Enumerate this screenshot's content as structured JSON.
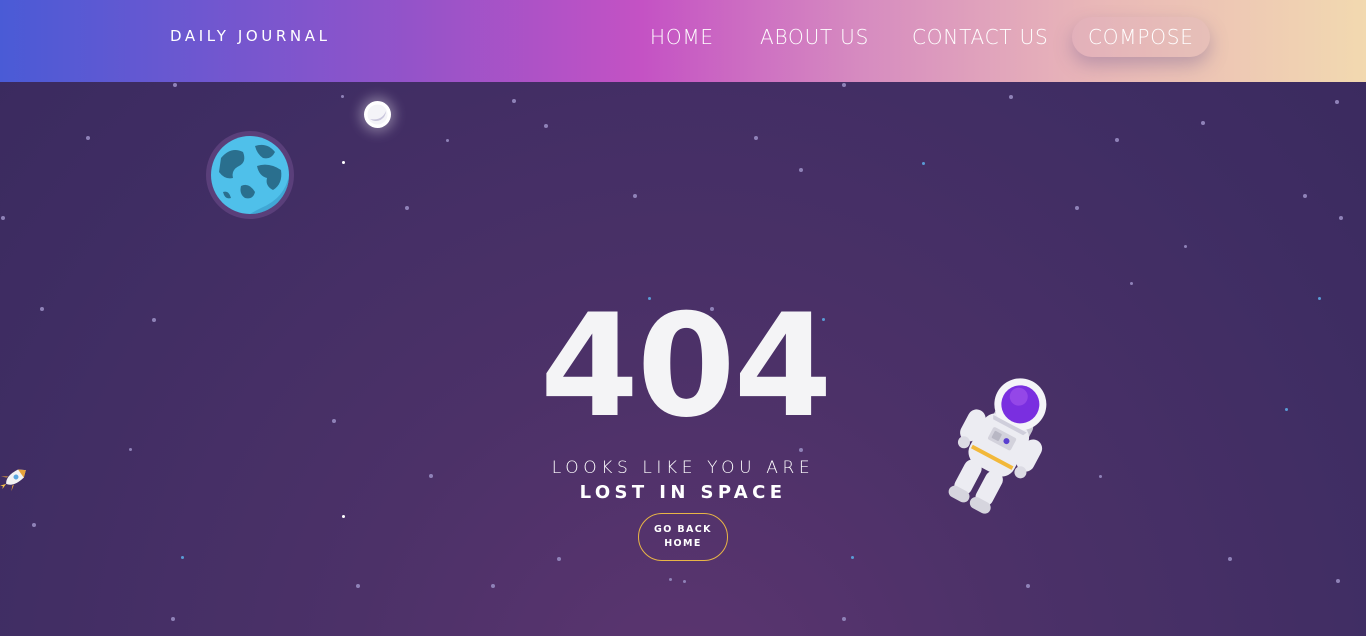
{
  "navbar": {
    "brand": "DAILY JOURNAL",
    "links": [
      {
        "label": "HOME"
      },
      {
        "label": "ABOUT US"
      },
      {
        "label": "CONTACT US"
      },
      {
        "label": "COMPOSE"
      }
    ]
  },
  "error": {
    "code": "404",
    "line1": "LOOKS LIKE YOU ARE",
    "line2": "LOST IN SPACE",
    "button_label": "GO BACK\nHOME"
  },
  "icons": [
    "planet-icon",
    "moon-icon",
    "rocket-icon",
    "astronaut-icon"
  ],
  "colors": {
    "background": "#3f2d63",
    "nav_gradient_start": "#4a5bd6",
    "nav_gradient_mid": "#c452c4",
    "nav_gradient_end": "#f2d9b0",
    "button_border": "#e8b546"
  }
}
